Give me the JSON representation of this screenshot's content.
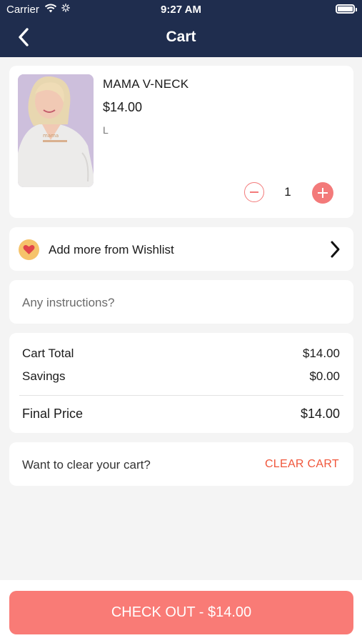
{
  "status_bar": {
    "carrier": "Carrier",
    "time": "9:27 AM"
  },
  "nav": {
    "title": "Cart",
    "back_icon": "chevron-left-icon"
  },
  "cart_item": {
    "name": "MAMA V-NECK",
    "price": "$14.00",
    "size": "L",
    "quantity": "1",
    "image_icon": "product-photo"
  },
  "wishlist": {
    "label": "Add more from Wishlist",
    "icon": "heart-icon"
  },
  "instructions": {
    "placeholder": "Any instructions?"
  },
  "summary": {
    "rows": [
      {
        "label": "Cart Total",
        "value": "$14.00"
      },
      {
        "label": "Savings",
        "value": "$0.00"
      }
    ],
    "final": {
      "label": "Final Price",
      "value": "$14.00"
    }
  },
  "clear": {
    "prompt": "Want to clear your cart?",
    "button": "CLEAR CART"
  },
  "checkout": {
    "label": "CHECK OUT - $14.00"
  },
  "colors": {
    "header": "#1f2d4e",
    "accent": "#f37a7a",
    "clear_text": "#f0563b",
    "checkout_bg": "#f97b76",
    "heart_badge": "#f6c36b"
  }
}
